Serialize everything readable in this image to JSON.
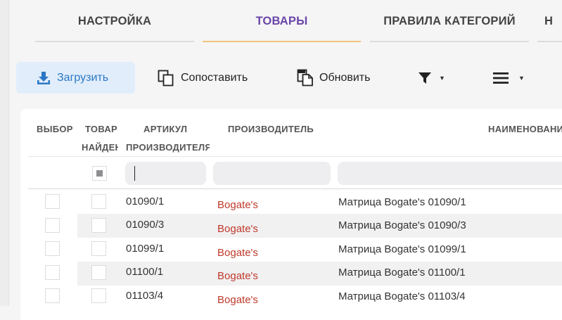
{
  "tabs": [
    {
      "label": "НАСТРОЙКА",
      "active": false
    },
    {
      "label": "ТОВАРЫ",
      "active": true
    },
    {
      "label": "ПРАВИЛА КАТЕГОРИЙ",
      "active": false
    },
    {
      "label": "Н",
      "active": false
    }
  ],
  "toolbar": {
    "upload_label": "Загрузить",
    "match_label": "Сопоставить",
    "refresh_label": "Обновить",
    "filter_caret": "▼",
    "menu_caret": "▼"
  },
  "table": {
    "headers": {
      "select": "ВЫБОР",
      "found_line1": "ТОВАР",
      "found_line2": "НАЙДЕН",
      "article_line1": "АРТИКУЛ",
      "article_line2": "ПРОИЗВОДИТЕЛЯ",
      "maker": "ПРОИЗВОДИТЕЛЬ",
      "name": "НАИМЕНОВАНИЕ"
    },
    "rows": [
      {
        "article": "01090/1",
        "maker": "Bogate's",
        "name": "Матрица Bogate's 01090/1"
      },
      {
        "article": "01090/3",
        "maker": "Bogate's",
        "name": "Матрица Bogate's 01090/3"
      },
      {
        "article": "01099/1",
        "maker": "Bogate's",
        "name": "Матрица Bogate's 01099/1"
      },
      {
        "article": "01100/1",
        "maker": "Bogate's",
        "name": "Матрица Bogate's 01100/1"
      },
      {
        "article": "01103/4",
        "maker": "Bogate's",
        "name": "Матрица Bogate's 01103/4"
      }
    ]
  },
  "colors": {
    "accent": "#6a45a8",
    "active_underline": "#f1c27d",
    "primary_button_bg": "#e1edfb",
    "primary_button_text": "#2b78c4",
    "maker_text": "#c0392b"
  },
  "icons": {
    "upload": "upload-icon",
    "match": "copy-icon",
    "refresh": "document-icon",
    "filter": "filter-icon",
    "menu": "hamburger-menu-icon"
  }
}
